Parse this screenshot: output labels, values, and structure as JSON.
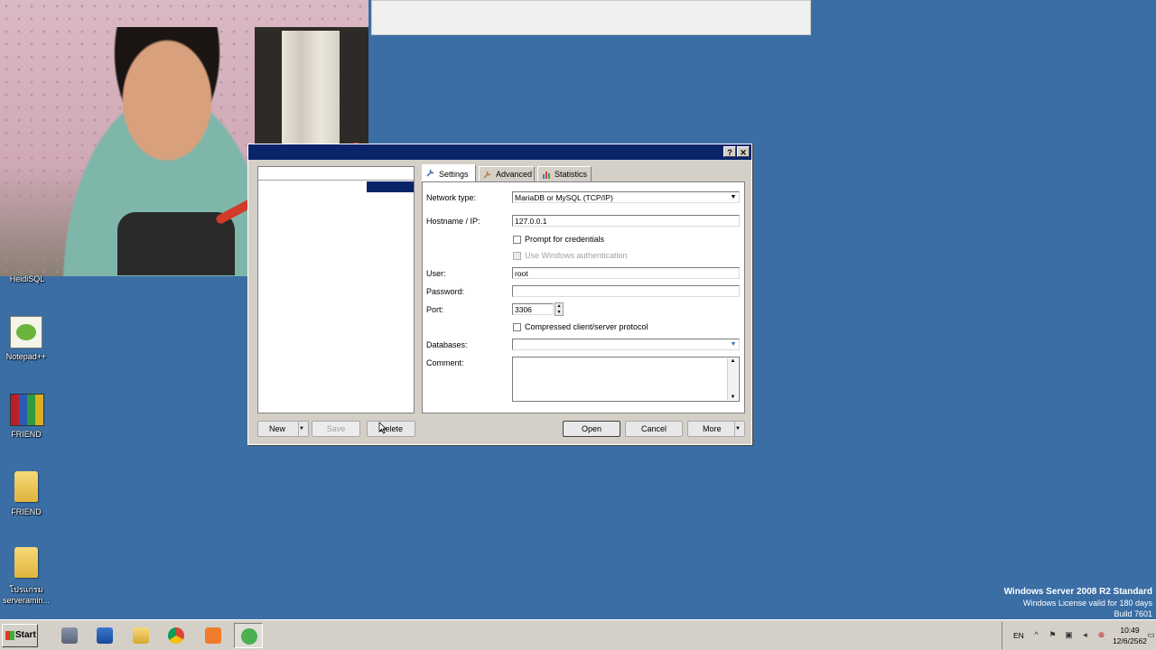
{
  "desktop": {
    "icons": [
      {
        "label": "HeidiSQL"
      },
      {
        "label": "Notepad++"
      },
      {
        "label": "FRIEND"
      },
      {
        "label": "FRIEND"
      },
      {
        "label": "โปรแกรม serveramin..."
      }
    ]
  },
  "dialog": {
    "help_btn": "?",
    "close_btn": "✕",
    "tabs": [
      "Settings",
      "Advanced",
      "Statistics"
    ],
    "settings": {
      "network_type_label": "Network type:",
      "network_type_value": "MariaDB or MySQL (TCP/IP)",
      "hostname_label": "Hostname / IP:",
      "hostname_value": "127.0.0.1",
      "prompt_credentials_label": "Prompt for credentials",
      "windows_auth_label": "Use Windows authentication",
      "user_label": "User:",
      "user_value": "root",
      "password_label": "Password:",
      "password_value": "",
      "port_label": "Port:",
      "port_value": "3306",
      "compressed_label": "Compressed client/server protocol",
      "databases_label": "Databases:",
      "databases_value": "",
      "comment_label": "Comment:"
    },
    "buttons": {
      "new": "New",
      "save": "Save",
      "delete": "Delete",
      "open": "Open",
      "cancel": "Cancel",
      "more": "More"
    }
  },
  "taskbar": {
    "start_label": "Start",
    "language": "EN",
    "time": "10:49",
    "date": "12/6/2562"
  },
  "watermark": {
    "line1": "Windows Server 2008 R2 Standard",
    "line2": "Windows License valid for 180 days",
    "line3": "Build 7601"
  },
  "colors": {
    "desktop": "#3a6ea5",
    "titlebar": "#0a246a",
    "selection": "#0a246a"
  }
}
